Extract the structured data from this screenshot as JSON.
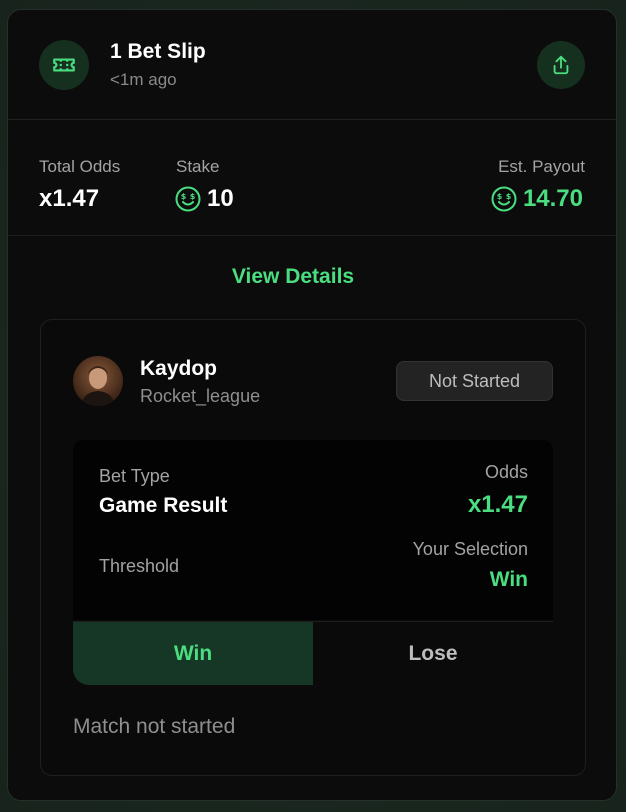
{
  "header": {
    "title": "1 Bet Slip",
    "subtitle": "<1m ago",
    "ticket_icon": "ticket-icon",
    "share_icon": "share-icon"
  },
  "stats": {
    "total_odds_label": "Total Odds",
    "total_odds_value": "x1.47",
    "stake_label": "Stake",
    "stake_value": "10",
    "payout_label": "Est. Payout",
    "payout_value": "14.70",
    "currency_icon": "coin-smiley-icon"
  },
  "view_details_label": "View Details",
  "bet": {
    "player_name": "Kaydop",
    "game": "Rocket_league",
    "status": "Not Started",
    "bet_type_label": "Bet Type",
    "bet_type_value": "Game Result",
    "odds_label": "Odds",
    "odds_value": "x1.47",
    "threshold_label": "Threshold",
    "selection_label": "Your Selection",
    "selection_value": "Win",
    "options": [
      "Win",
      "Lose"
    ],
    "selected_option": "Win",
    "match_status": "Match not started"
  },
  "colors": {
    "accent": "#4ade80",
    "card_bg": "#0c0c0c",
    "icon_bg": "#16301f",
    "active_option_bg": "#173726"
  }
}
